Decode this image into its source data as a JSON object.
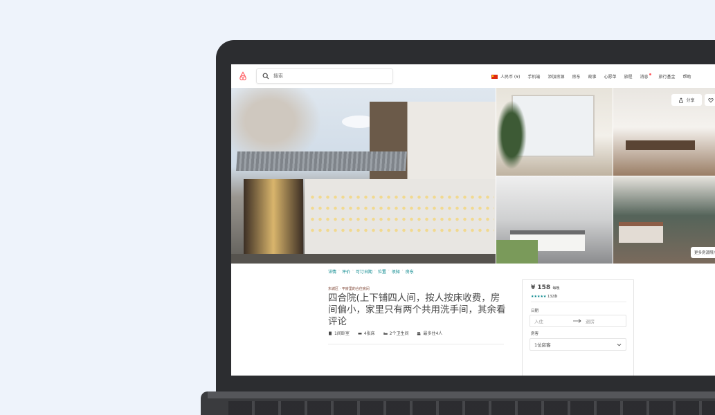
{
  "header": {
    "search_placeholder": "搜索",
    "nav": {
      "currency": "人民币 (¥)",
      "mobile": "手机端",
      "host": "添加房源",
      "landlord": "房东",
      "stories": "故事",
      "wishlist": "心愿单",
      "trips": "旅程",
      "messages": "消息",
      "travel_fund": "旅行基金",
      "help": "帮助"
    }
  },
  "gallery": {
    "share": "分享",
    "save": "保",
    "more_photos": "更多房源照片"
  },
  "subnav": [
    "详情",
    "评价",
    "可订日期",
    "位置",
    "须知",
    "房东"
  ],
  "listing": {
    "location": "东城区 · 平房里的合住房间",
    "title": "四合院(上下铺四人间，按人按床收费，房间偏小，家里只有两个共用洗手间，其余看评论",
    "facts": {
      "rooms": "1间卧室",
      "beds": "4张床",
      "baths": "2个卫生间",
      "guests": "最多住4人"
    }
  },
  "booking": {
    "price": "¥ 158",
    "price_unit": "每晚",
    "stars": "★★★★★",
    "review_count": "132条",
    "dates_label": "日期",
    "checkin": "入住",
    "checkout": "退房",
    "guests_label": "房客",
    "guests_value": "1位房客"
  },
  "colors": {
    "brand": "#ff5a5f",
    "teal": "#008489",
    "text": "#484848"
  }
}
